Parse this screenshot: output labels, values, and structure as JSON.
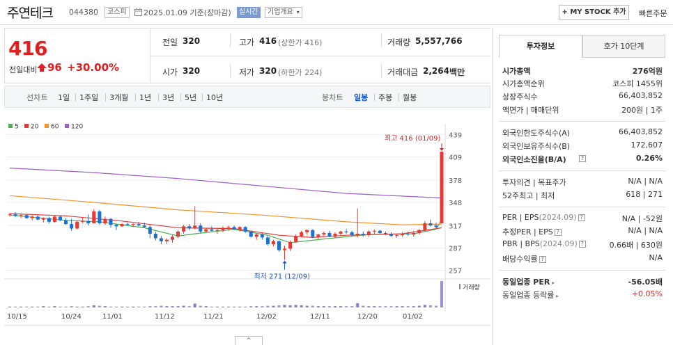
{
  "header": {
    "stock_name": "주연테크",
    "stock_code": "044380",
    "market_tag": "코스피",
    "date_text": "2025.01.09 기준(장마감)",
    "realtime_label": "실시간",
    "overview_label": "기업개요",
    "mystock_label": "+ MY STOCK 추가",
    "quick_order_label": "빠른주문"
  },
  "price": {
    "current": "416",
    "change_label": "전일대비",
    "change_value": "96",
    "change_rate": "+30.00%"
  },
  "summary": {
    "prev_label": "전일",
    "prev_value": "320",
    "high_label": "고가",
    "high_value": "416",
    "high_sub": "(상한가 416)",
    "volume_label": "거래량",
    "volume_value": "5,557,766",
    "open_label": "시가",
    "open_value": "320",
    "low_label": "저가",
    "low_value": "320",
    "low_sub": "(하한가 224)",
    "amount_label": "거래대금",
    "amount_value": "2,264",
    "amount_unit": "백만"
  },
  "chart_tabs": {
    "line_label": "선차트",
    "periods": [
      "1일",
      "1주일",
      "3개월",
      "1년",
      "3년",
      "5년",
      "10년"
    ],
    "candle_label": "봉차트",
    "candle_periods": [
      "일봉",
      "주봉",
      "월봉"
    ],
    "active_candle": "일봉"
  },
  "chart_data": {
    "type": "candlestick",
    "legend": [
      {
        "name": "5",
        "color": "#4caf50"
      },
      {
        "name": "20",
        "color": "#e53935"
      },
      {
        "name": "60",
        "color": "#f0922b"
      },
      {
        "name": "120",
        "color": "#9c5fc8"
      }
    ],
    "y_ticks": [
      439,
      409,
      378,
      348,
      317,
      287,
      257
    ],
    "ylim": [
      252,
      444
    ],
    "x_labels": [
      "10/15",
      "10/24",
      "11/01",
      "11/12",
      "11/21",
      "12/02",
      "12/11",
      "12/20",
      "01/02"
    ],
    "max_annotation": "최고 416 (01/09)",
    "min_annotation": "최저 271 (12/09)",
    "volume_label": "거래량",
    "up_color": "#e53935",
    "down_color": "#1e6fd0",
    "candles": [
      [
        331,
        334,
        329,
        332
      ],
      [
        332,
        335,
        328,
        330
      ],
      [
        330,
        333,
        327,
        331
      ],
      [
        331,
        332,
        326,
        327
      ],
      [
        327,
        330,
        324,
        329
      ],
      [
        329,
        331,
        324,
        325
      ],
      [
        325,
        328,
        321,
        327
      ],
      [
        327,
        329,
        320,
        322
      ],
      [
        322,
        331,
        321,
        329
      ],
      [
        329,
        330,
        323,
        324
      ],
      [
        324,
        327,
        318,
        319
      ],
      [
        319,
        326,
        310,
        313
      ],
      [
        313,
        324,
        312,
        322
      ],
      [
        322,
        327,
        320,
        323
      ],
      [
        323,
        332,
        317,
        320
      ],
      [
        320,
        339,
        320,
        336
      ],
      [
        336,
        338,
        318,
        320
      ],
      [
        320,
        329,
        318,
        326
      ],
      [
        326,
        327,
        314,
        318
      ],
      [
        318,
        319,
        311,
        316
      ],
      [
        316,
        320,
        315,
        319
      ],
      [
        319,
        321,
        317,
        318
      ],
      [
        318,
        320,
        315,
        319
      ],
      [
        319,
        322,
        316,
        317
      ],
      [
        317,
        321,
        314,
        315
      ],
      [
        315,
        317,
        300,
        306
      ],
      [
        306,
        309,
        297,
        300
      ],
      [
        300,
        303,
        292,
        296
      ],
      [
        296,
        300,
        292,
        298
      ],
      [
        298,
        304,
        294,
        302
      ],
      [
        302,
        311,
        300,
        309
      ],
      [
        309,
        318,
        306,
        316
      ],
      [
        316,
        319,
        311,
        313
      ],
      [
        313,
        343,
        312,
        317
      ],
      [
        317,
        320,
        307,
        309
      ],
      [
        309,
        314,
        308,
        312
      ],
      [
        312,
        316,
        309,
        310
      ],
      [
        310,
        313,
        306,
        311
      ],
      [
        311,
        316,
        308,
        314
      ],
      [
        314,
        317,
        310,
        315
      ],
      [
        315,
        317,
        311,
        312
      ],
      [
        312,
        316,
        309,
        315
      ],
      [
        315,
        316,
        307,
        309
      ],
      [
        309,
        310,
        301,
        302
      ],
      [
        302,
        306,
        298,
        305
      ],
      [
        305,
        307,
        298,
        301
      ],
      [
        301,
        303,
        290,
        292
      ],
      [
        292,
        298,
        289,
        296
      ],
      [
        296,
        297,
        282,
        284
      ],
      [
        284,
        290,
        271,
        286
      ],
      [
        286,
        297,
        283,
        295
      ],
      [
        295,
        305,
        294,
        303
      ],
      [
        303,
        310,
        301,
        308
      ],
      [
        308,
        312,
        305,
        311
      ],
      [
        311,
        312,
        300,
        302
      ],
      [
        302,
        306,
        299,
        305
      ],
      [
        305,
        309,
        303,
        307
      ],
      [
        307,
        310,
        301,
        302
      ],
      [
        302,
        308,
        300,
        306
      ],
      [
        306,
        310,
        304,
        309
      ],
      [
        309,
        312,
        306,
        308
      ],
      [
        308,
        310,
        302,
        304
      ],
      [
        304,
        340,
        301,
        306
      ],
      [
        306,
        309,
        302,
        304
      ],
      [
        304,
        311,
        302,
        309
      ],
      [
        309,
        312,
        306,
        310
      ],
      [
        310,
        311,
        305,
        307
      ],
      [
        307,
        309,
        304,
        306
      ],
      [
        306,
        308,
        302,
        303
      ],
      [
        303,
        306,
        301,
        304
      ],
      [
        304,
        308,
        302,
        306
      ],
      [
        306,
        309,
        303,
        305
      ],
      [
        305,
        310,
        302,
        307
      ],
      [
        307,
        312,
        305,
        311
      ],
      [
        311,
        323,
        309,
        320
      ],
      [
        320,
        325,
        316,
        317
      ],
      [
        317,
        321,
        313,
        315
      ],
      [
        320,
        416,
        320,
        416
      ]
    ],
    "ma_series": {
      "ma5": [
        [
          0,
          331
        ],
        [
          10,
          324
        ],
        [
          16,
          322
        ],
        [
          24,
          314
        ],
        [
          30,
          303
        ],
        [
          33,
          306
        ],
        [
          40,
          312
        ],
        [
          46,
          304
        ],
        [
          50,
          294
        ],
        [
          56,
          299
        ],
        [
          64,
          305
        ],
        [
          72,
          306
        ],
        [
          76,
          312
        ],
        [
          77,
          325
        ]
      ],
      "ma20": [
        [
          0,
          333
        ],
        [
          10,
          330
        ],
        [
          20,
          323
        ],
        [
          30,
          314
        ],
        [
          40,
          313
        ],
        [
          48,
          304
        ],
        [
          54,
          301
        ],
        [
          60,
          304
        ],
        [
          70,
          306
        ],
        [
          77,
          314
        ]
      ],
      "ma60": [
        [
          0,
          357
        ],
        [
          15,
          348
        ],
        [
          30,
          338
        ],
        [
          45,
          331
        ],
        [
          60,
          322
        ],
        [
          70,
          318
        ],
        [
          77,
          319
        ]
      ],
      "ma120": [
        [
          0,
          394
        ],
        [
          15,
          388
        ],
        [
          30,
          380
        ],
        [
          45,
          370
        ],
        [
          60,
          360
        ],
        [
          77,
          354
        ]
      ]
    },
    "volume": [
      2,
      2,
      2,
      2,
      2,
      2,
      3,
      2,
      3,
      2,
      2,
      3,
      2,
      2,
      3,
      5,
      4,
      3,
      2,
      2,
      2,
      2,
      2,
      2,
      2,
      3,
      3,
      4,
      3,
      3,
      3,
      4,
      3,
      9,
      4,
      3,
      2,
      2,
      2,
      2,
      2,
      2,
      2,
      3,
      3,
      3,
      4,
      4,
      5,
      6,
      5,
      6,
      5,
      4,
      4,
      3,
      3,
      3,
      3,
      3,
      3,
      3,
      10,
      4,
      3,
      3,
      3,
      3,
      3,
      3,
      3,
      3,
      3,
      4,
      6,
      5,
      4,
      62
    ]
  },
  "right_panel": {
    "tab_invest": "투자정보",
    "tab_quote": "호가 10단계",
    "market_cap_label": "시가총액",
    "market_cap_value": "276억원",
    "market_cap_rank_label": "시가총액순위",
    "market_cap_rank_value": "코스피 1455위",
    "shares_label": "상장주식수",
    "shares_value": "66,403,852",
    "par_label": "액면가 | 매매단위",
    "par_value": "200원 | 1주",
    "foreign_limit_label": "외국인한도주식수(A)",
    "foreign_limit_value": "66,403,852",
    "foreign_hold_label": "외국인보유주식수(B)",
    "foreign_hold_value": "172,607",
    "foreign_rate_label": "외국인소진율(B/A)",
    "foreign_rate_value": "0.26%",
    "opinion_label": "투자의견 | 목표주가",
    "opinion_value": "N/A | N/A",
    "week52_label": "52주최고 | 최저",
    "week52_value": "618 | 271",
    "per_label": "PER | EPS",
    "per_date": "(2024.09)",
    "per_value": "N/A | -52원",
    "est_per_label": "추정PER | EPS",
    "est_per_value": "N/A | N/A",
    "pbr_label": "PBR | BPS",
    "pbr_date": "(2024.09)",
    "pbr_value": "0.66배 | 630원",
    "div_label": "배당수익률",
    "div_value": "N/A",
    "ind_per_label": "동일업종 PER",
    "ind_per_value": "-56.05배",
    "ind_rate_label": "동일업종 등락률",
    "ind_rate_value": "+0.05%"
  },
  "toggle_label": "^"
}
